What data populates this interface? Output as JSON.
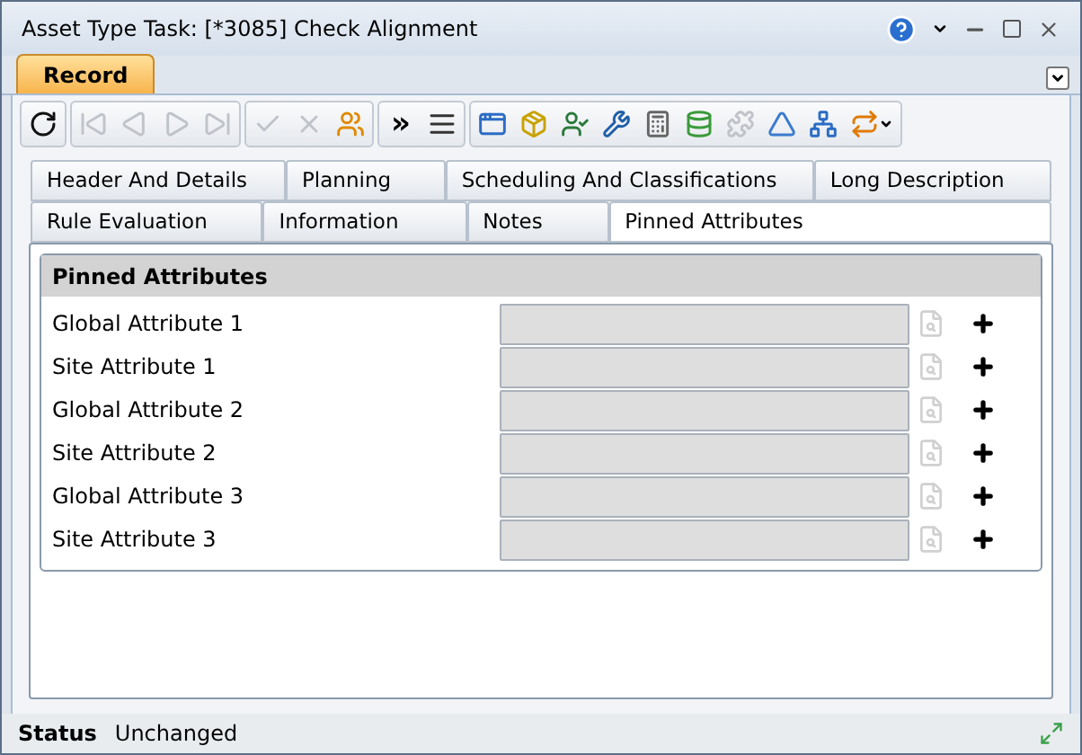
{
  "window": {
    "title": "Asset Type Task: [*3085] Check Alignment"
  },
  "record_tab": {
    "label": "Record",
    "selected": true
  },
  "toolbar": {
    "groups": [
      {
        "items": [
          {
            "kind": "icon",
            "disabled": false
          }
        ]
      },
      {
        "items": [
          {
            "kind": "icon",
            "disabled": true
          },
          {
            "kind": "icon",
            "disabled": true
          },
          {
            "kind": "icon",
            "disabled": true
          },
          {
            "kind": "icon",
            "disabled": true
          }
        ]
      },
      {
        "items": [
          {
            "kind": "icon",
            "disabled": true
          },
          {
            "kind": "icon",
            "disabled": true
          },
          {
            "kind": "icon",
            "disabled": false
          }
        ]
      },
      {
        "items": [
          {
            "kind": "text",
            "label": "»",
            "disabled": false
          },
          {
            "kind": "icon",
            "disabled": false
          }
        ]
      },
      {
        "items": [
          {
            "kind": "icon",
            "disabled": false
          },
          {
            "kind": "icon",
            "disabled": false
          },
          {
            "kind": "icon",
            "disabled": false
          },
          {
            "kind": "icon",
            "disabled": false
          },
          {
            "kind": "icon",
            "disabled": false
          },
          {
            "kind": "icon",
            "disabled": false
          },
          {
            "kind": "icon",
            "disabled": true
          },
          {
            "kind": "icon",
            "disabled": false
          },
          {
            "kind": "icon",
            "disabled": false
          },
          {
            "kind": "icon",
            "disabled": false
          }
        ]
      }
    ]
  },
  "tabs": [
    [
      {
        "label": "Header And Details",
        "selected": false
      },
      {
        "label": "Planning",
        "selected": false
      },
      {
        "label": "Scheduling And Classifications",
        "selected": false
      },
      {
        "label": "Long Description",
        "selected": false
      }
    ],
    [
      {
        "label": "Rule Evaluation",
        "selected": false
      },
      {
        "label": "Information",
        "selected": false
      },
      {
        "label": "Notes",
        "selected": false
      },
      {
        "label": "Pinned Attributes",
        "selected": true
      }
    ]
  ],
  "section": {
    "title": "Pinned Attributes",
    "rows": [
      {
        "label": "Global Attribute 1"
      },
      {
        "label": "Site Attribute 1"
      },
      {
        "label": "Global Attribute 2"
      },
      {
        "label": "Site Attribute 2"
      },
      {
        "label": "Global Attribute 3"
      },
      {
        "label": "Site Attribute 3"
      }
    ]
  },
  "status_bar": {
    "label": "Status",
    "value": "Unchanged"
  }
}
